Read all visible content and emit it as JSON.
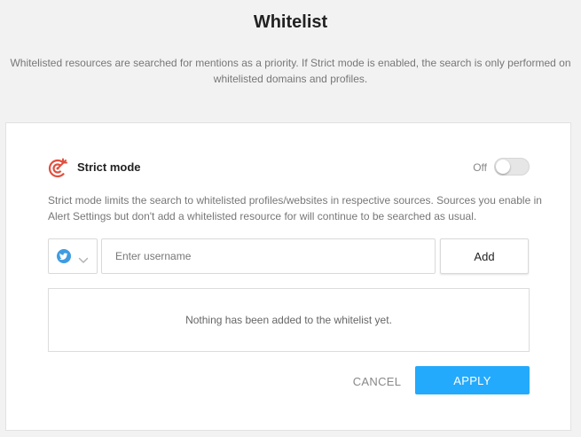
{
  "page": {
    "title": "Whitelist",
    "subtitle": "Whitelisted resources are searched for mentions as a priority. If Strict mode is enabled, the search is only performed on whitelisted domains and profiles."
  },
  "strict_mode": {
    "label": "Strict mode",
    "icon": "target-icon",
    "toggle_state": "Off",
    "enabled": false,
    "description": "Strict mode limits the search to whitelisted profiles/websites in respective sources. Sources you enable in Alert Settings but don't add a whitelisted resource for will continue to be searched as usual."
  },
  "form": {
    "source_icon": "twitter-icon",
    "username_value": "",
    "username_placeholder": "Enter username",
    "add_label": "Add"
  },
  "whitelist": {
    "empty_message": "Nothing has been added to the whitelist yet."
  },
  "actions": {
    "cancel_label": "CANCEL",
    "apply_label": "APPLY"
  },
  "colors": {
    "accent": "#24aafc",
    "strict_icon": "#e0503f",
    "twitter": "#3f9ce0",
    "background": "#f2f2f2"
  }
}
